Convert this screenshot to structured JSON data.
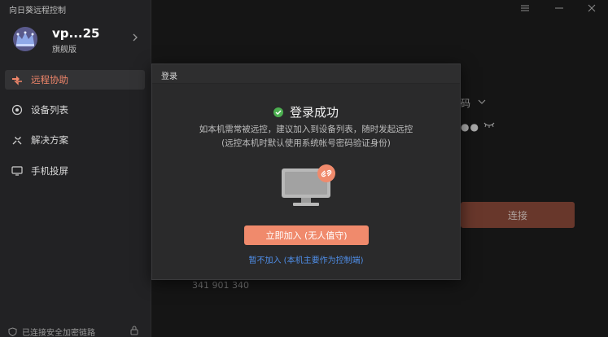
{
  "app": {
    "title": "向日葵远程控制"
  },
  "profile": {
    "username": "vp...25",
    "edition": "旗舰版"
  },
  "nav": [
    {
      "label": "远程协助",
      "icon": "remote-assist-icon",
      "active": true
    },
    {
      "label": "设备列表",
      "icon": "device-list-icon",
      "active": false
    },
    {
      "label": "解决方案",
      "icon": "solution-icon",
      "active": false
    },
    {
      "label": "手机投屏",
      "icon": "phone-cast-icon",
      "active": false
    }
  ],
  "footer": {
    "status": "已连接安全加密链路"
  },
  "background": {
    "code_label": "码",
    "password_mask": "●●",
    "connect_label": "连接",
    "partial_id": "341 901 340"
  },
  "dialog": {
    "title": "登录",
    "success": "登录成功",
    "desc_line1": "如本机需常被远控，建议加入到设备列表，随时发起远控",
    "desc_line2": "(远控本机时默认使用系统帐号密码验证身份)",
    "primary_button": "立即加入 (无人值守)",
    "secondary_link": "暂不加入 (本机主要作为控制端)"
  },
  "colors": {
    "accent": "#f08a6c",
    "success": "#4caf50",
    "link": "#4f8ee8"
  }
}
